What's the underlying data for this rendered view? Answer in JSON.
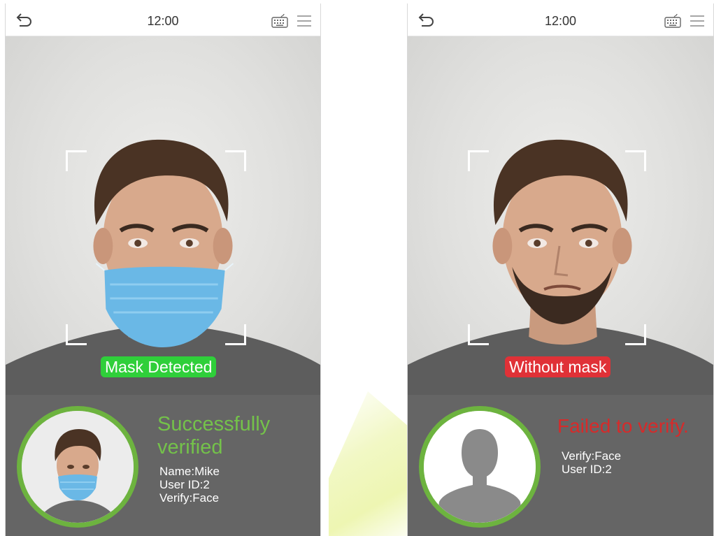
{
  "colors": {
    "success_green": "#74c24a",
    "badge_green": "#2fcf3a",
    "badge_red": "#e03137",
    "fail_red": "#d72a2a",
    "ring_green": "#6db33f",
    "panel_gray": "#585858"
  },
  "icons": {
    "back": "back-arrow-icon",
    "keyboard": "keyboard-icon",
    "menu": "menu-icon"
  },
  "left_screen": {
    "time": "12:00",
    "badge": "Mask Detected",
    "result_title": "Successfully verified",
    "lines": [
      "Name:Mike",
      "User ID:2",
      "Verify:Face"
    ]
  },
  "right_screen": {
    "time": "12:00",
    "badge": "Without mask",
    "result_title": "Failed to verify.",
    "lines": [
      "Verify:Face",
      "User ID:2"
    ]
  }
}
